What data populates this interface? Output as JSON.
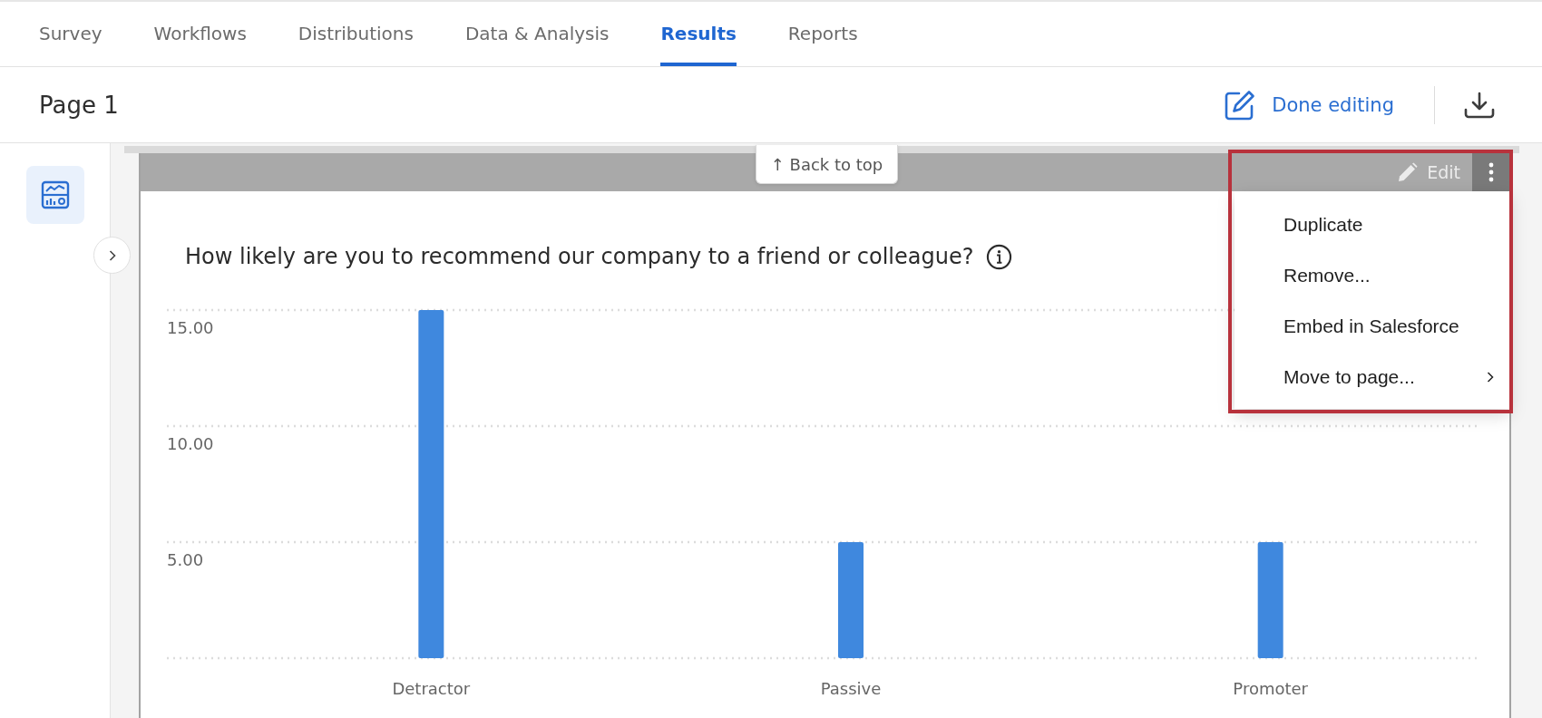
{
  "tabs": [
    {
      "label": "Survey",
      "selected": false
    },
    {
      "label": "Workflows",
      "selected": false
    },
    {
      "label": "Distributions",
      "selected": false
    },
    {
      "label": "Data & Analysis",
      "selected": false
    },
    {
      "label": "Results",
      "selected": true
    },
    {
      "label": "Reports",
      "selected": false
    }
  ],
  "page_header": {
    "title": "Page 1",
    "done_button": "Done editing"
  },
  "widget": {
    "back_to_top": "↑ Back to top",
    "edit_button": "Edit",
    "menu": {
      "items": [
        {
          "label": "Duplicate",
          "submenu": false
        },
        {
          "label": "Remove...",
          "submenu": false
        },
        {
          "label": "Embed in Salesforce",
          "submenu": false
        },
        {
          "label": "Move to page...",
          "submenu": true
        }
      ]
    },
    "chart_data": {
      "type": "bar",
      "title": "How likely are you to recommend our company to a friend or colleague?",
      "categories": [
        "Detractor",
        "Passive",
        "Promoter"
      ],
      "series": [
        {
          "color": "#3f88de",
          "values": [
            15,
            5,
            5
          ]
        }
      ],
      "ylim": [
        0,
        15
      ],
      "yticks": [
        {
          "value": 5,
          "label": "5.00"
        },
        {
          "value": 10,
          "label": "10.00"
        },
        {
          "value": 15,
          "label": "15.00"
        }
      ]
    }
  }
}
